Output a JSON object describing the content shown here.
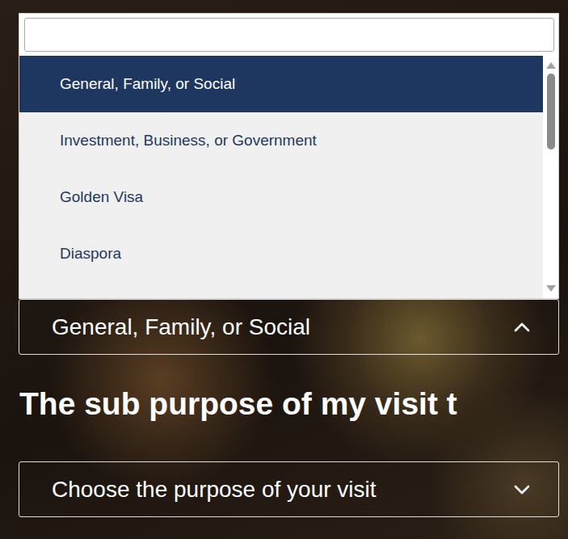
{
  "dropdown": {
    "search": {
      "value": ""
    },
    "options": [
      {
        "label": "General, Family, or Social",
        "selected": true
      },
      {
        "label": "Investment, Business, or Government",
        "selected": false
      },
      {
        "label": "Golden Visa",
        "selected": false
      },
      {
        "label": "Diaspora",
        "selected": false
      }
    ]
  },
  "purpose_select": {
    "value": "General, Family, or Social",
    "expanded": true
  },
  "sub_heading": "The sub purpose of my visit t",
  "sub_purpose_select": {
    "placeholder": "Choose the purpose of your visit",
    "expanded": false
  }
}
